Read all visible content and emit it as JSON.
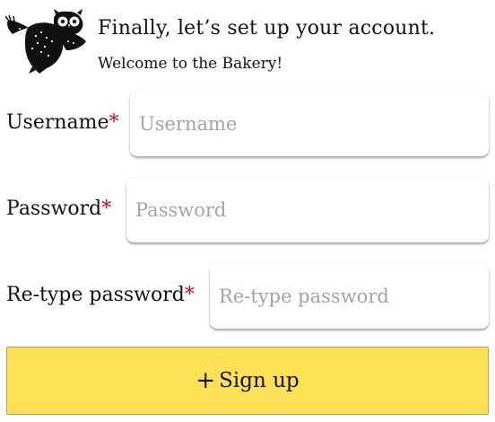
{
  "header": {
    "logo_icon": "owl-logo-icon",
    "title": "Finally, let’s set up your account.",
    "subtitle": "Welcome to the Bakery!"
  },
  "form": {
    "username": {
      "label": "Username",
      "required_mark": "*",
      "placeholder": "Username",
      "value": ""
    },
    "password": {
      "label": "Password",
      "required_mark": "*",
      "placeholder": "Password",
      "value": ""
    },
    "retype_password": {
      "label": "Re-type password",
      "required_mark": "*",
      "placeholder": "Re-type password",
      "value": ""
    }
  },
  "signup_button": {
    "icon": "plus-icon",
    "icon_glyph": "+",
    "label": "Sign up"
  },
  "colors": {
    "button_background": "#fce157",
    "required_mark": "#d0021b",
    "placeholder": "#a3a3a3"
  }
}
